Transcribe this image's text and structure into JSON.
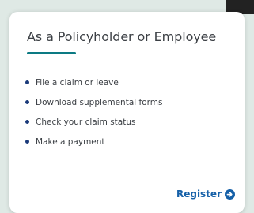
{
  "card": {
    "title": "As a Policyholder or Employee",
    "accent_color": "#0c7a83",
    "items": [
      {
        "label": "File a claim or leave"
      },
      {
        "label": "Download supplemental forms"
      },
      {
        "label": "Check your claim status"
      },
      {
        "label": "Make a payment"
      }
    ],
    "register": {
      "label": "Register",
      "icon": "arrow-right-circle-icon",
      "color": "#1560a8"
    }
  }
}
